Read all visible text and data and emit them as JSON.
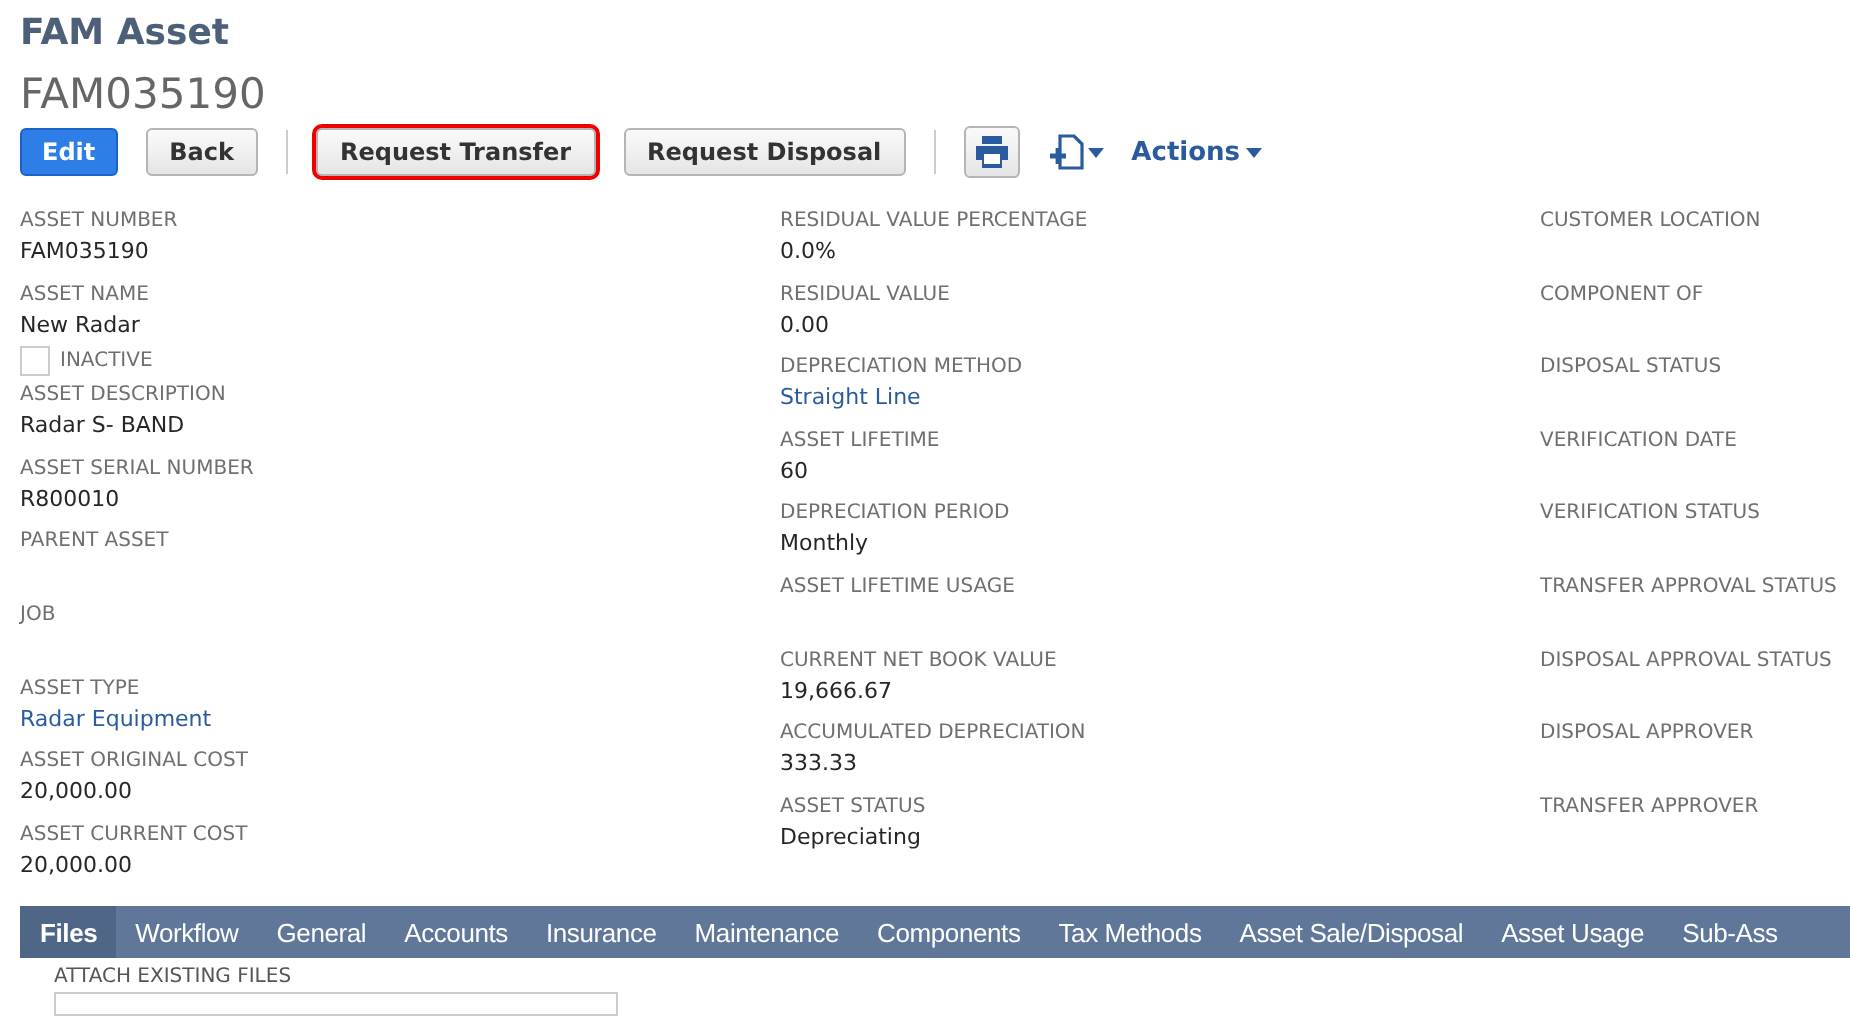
{
  "page": {
    "title": "FAM Asset",
    "record_id": "FAM035190"
  },
  "toolbar": {
    "buttons": [
      {
        "label": "Edit",
        "kind": "primary",
        "highlighted": false
      },
      {
        "label": "Back",
        "kind": "secondary",
        "highlighted": false
      },
      {
        "kind": "separator"
      },
      {
        "label": "Request Transfer",
        "kind": "secondary",
        "highlighted": true
      },
      {
        "label": "Request Disposal",
        "kind": "secondary",
        "highlighted": false
      },
      {
        "kind": "separator"
      },
      {
        "kind": "print"
      },
      {
        "kind": "new-document"
      },
      {
        "label": "Actions",
        "kind": "menu"
      }
    ]
  },
  "columns": [
    [
      {
        "label": "ASSET NUMBER",
        "value": "FAM035190",
        "kind": "text"
      },
      {
        "label": "ASSET NAME",
        "value": "New Radar",
        "kind": "text"
      },
      {
        "label": "INACTIVE",
        "kind": "checkbox",
        "checked": false
      },
      {
        "label": "ASSET DESCRIPTION",
        "value": "Radar S- BAND",
        "kind": "text"
      },
      {
        "label": "ASSET SERIAL NUMBER",
        "value": "R800010",
        "kind": "text"
      },
      {
        "label": "PARENT ASSET",
        "kind": "text"
      },
      {
        "label": "JOB",
        "kind": "text"
      },
      {
        "label": "ASSET TYPE",
        "value": "Radar Equipment",
        "kind": "link"
      },
      {
        "label": "ASSET ORIGINAL COST",
        "value": "20,000.00",
        "kind": "text"
      },
      {
        "label": "ASSET CURRENT COST",
        "value": "20,000.00",
        "kind": "text"
      }
    ],
    [
      {
        "label": "RESIDUAL VALUE PERCENTAGE",
        "value": "0.0%",
        "kind": "text"
      },
      {
        "label": "RESIDUAL VALUE",
        "value": "0.00",
        "kind": "text"
      },
      {
        "label": "DEPRECIATION METHOD",
        "value": "Straight Line",
        "kind": "link"
      },
      {
        "label": "ASSET LIFETIME",
        "value": "60",
        "kind": "text"
      },
      {
        "label": "DEPRECIATION PERIOD",
        "value": "Monthly",
        "kind": "text"
      },
      {
        "label": "ASSET LIFETIME USAGE",
        "kind": "text"
      },
      {
        "label": "CURRENT NET BOOK VALUE",
        "value": "19,666.67",
        "kind": "text"
      },
      {
        "label": "ACCUMULATED DEPRECIATION",
        "value": "333.33",
        "kind": "text"
      },
      {
        "label": "ASSET STATUS",
        "value": "Depreciating",
        "kind": "text"
      }
    ],
    [
      {
        "label": "CUSTOMER LOCATION",
        "kind": "text"
      },
      {
        "label": "COMPONENT OF",
        "kind": "text"
      },
      {
        "label": "DISPOSAL STATUS",
        "kind": "text"
      },
      {
        "label": "VERIFICATION DATE",
        "kind": "text"
      },
      {
        "label": "VERIFICATION STATUS",
        "kind": "text"
      },
      {
        "label": "TRANSFER APPROVAL STATUS",
        "kind": "text"
      },
      {
        "label": "DISPOSAL APPROVAL STATUS",
        "kind": "text"
      },
      {
        "label": "DISPOSAL APPROVER",
        "kind": "text"
      },
      {
        "label": "TRANSFER APPROVER",
        "kind": "text"
      }
    ]
  ],
  "tabs": [
    {
      "label": "Files",
      "selected": true
    },
    {
      "label": "Workflow",
      "selected": false
    },
    {
      "label": "General",
      "selected": false
    },
    {
      "label": "Accounts",
      "selected": false
    },
    {
      "label": "Insurance",
      "selected": false
    },
    {
      "label": "Maintenance",
      "selected": false
    },
    {
      "label": "Components",
      "selected": false
    },
    {
      "label": "Tax Methods",
      "selected": false
    },
    {
      "label": "Asset Sale/Disposal",
      "selected": false
    },
    {
      "label": "Asset Usage",
      "selected": false
    },
    {
      "label": "Sub-Ass",
      "selected": false
    }
  ],
  "files_panel": {
    "label": "ATTACH EXISTING FILES"
  }
}
